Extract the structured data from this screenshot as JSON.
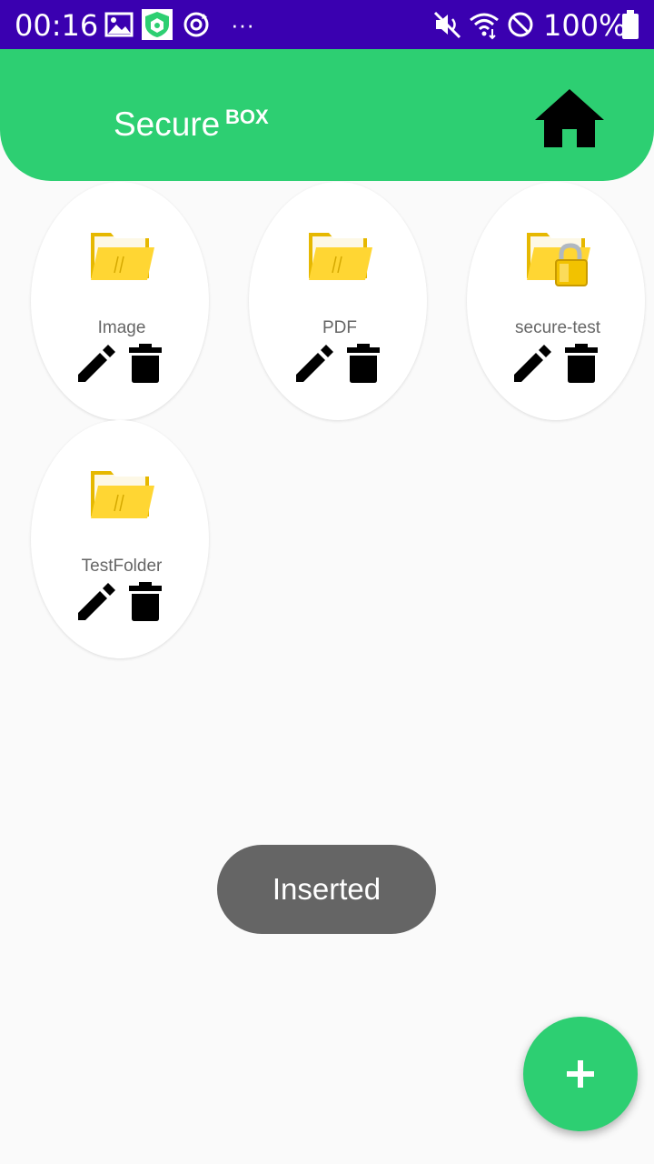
{
  "status_bar": {
    "time": "00:16",
    "battery": "100%",
    "overflow_dots": "···",
    "background_color": "#3a00b0",
    "icons": [
      "image-icon",
      "app-shield-icon",
      "sync-icon",
      "vibrate-icon",
      "wifi-icon",
      "do-not-disturb-icon",
      "battery-icon"
    ]
  },
  "header": {
    "title": "Secure",
    "title_superscript": "BOX",
    "home_icon": "home-icon",
    "color": "#2dcf72"
  },
  "folders": [
    {
      "label": "Image",
      "icon": "folder-icon",
      "locked": false
    },
    {
      "label": "PDF",
      "icon": "folder-icon",
      "locked": false
    },
    {
      "label": "secure-test",
      "icon": "locked-folder-icon",
      "locked": true
    },
    {
      "label": "TestFolder",
      "icon": "folder-icon",
      "locked": false
    }
  ],
  "toast": {
    "message": "Inserted"
  },
  "fab": {
    "icon": "plus-icon",
    "color": "#2dcf72"
  }
}
